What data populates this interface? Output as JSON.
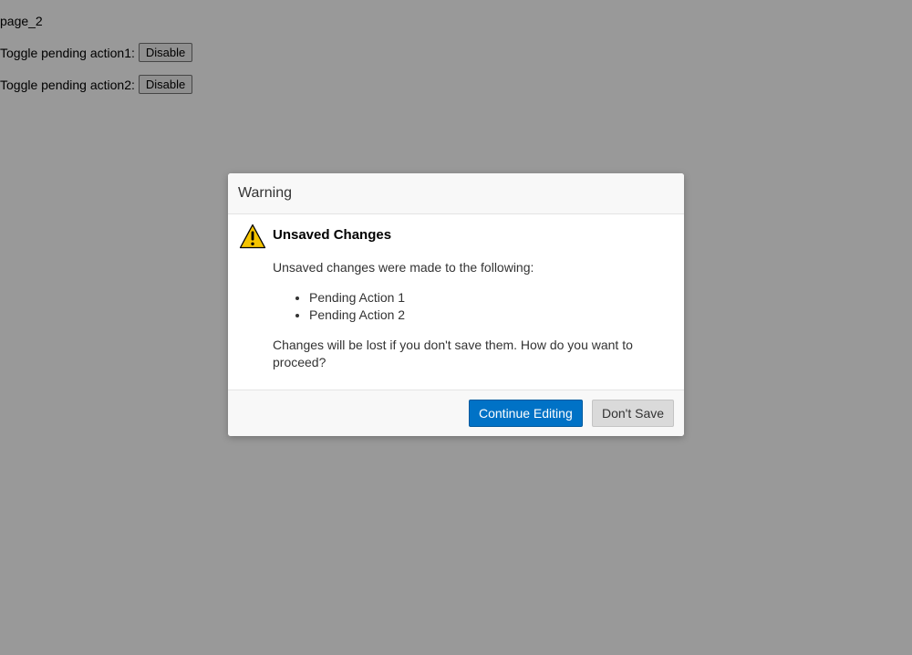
{
  "page": {
    "heading": "page_2",
    "toggles": [
      {
        "label": "Toggle pending action1:",
        "button": "Disable"
      },
      {
        "label": "Toggle pending action2:",
        "button": "Disable"
      }
    ]
  },
  "dialog": {
    "title": "Warning",
    "icon": "warning-icon",
    "body_title": "Unsaved Changes",
    "intro": "Unsaved changes were made to the following:",
    "items": [
      "Pending Action 1",
      "Pending Action 2"
    ],
    "outro": "Changes will be lost if you don't save them. How do you want to proceed?",
    "primary_button": "Continue Editing",
    "secondary_button": "Don't Save"
  },
  "colors": {
    "primary": "#0072c6",
    "warning_fill": "#f5c400",
    "overlay": "#999999"
  }
}
